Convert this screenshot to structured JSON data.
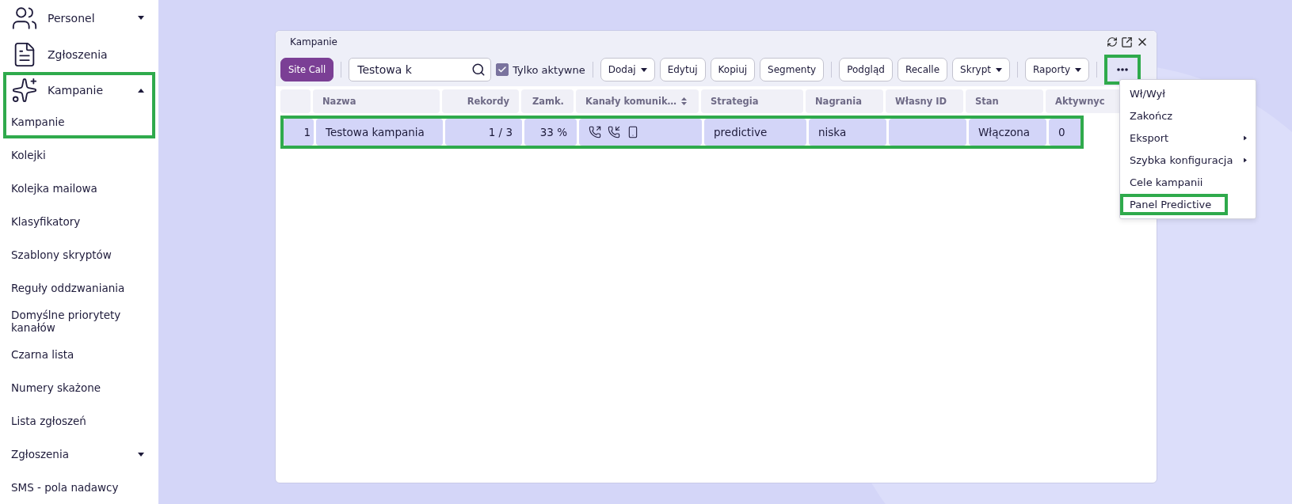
{
  "sidebar": {
    "items": [
      {
        "label": "Personel",
        "kind": "group",
        "expanded": false,
        "highlighted": false
      },
      {
        "label": "Zgłoszenia",
        "kind": "link",
        "highlighted": false
      },
      {
        "label": "Kampanie",
        "kind": "group",
        "expanded": true,
        "highlighted": true,
        "children": [
          {
            "label": "Kampanie",
            "kind": "link",
            "highlighted": true
          },
          {
            "label": "Kolejki",
            "kind": "link",
            "highlighted": false
          },
          {
            "label": "Kolejka mailowa",
            "kind": "link",
            "highlighted": false
          },
          {
            "label": "Klasyfikatory",
            "kind": "link",
            "highlighted": false
          },
          {
            "label": "Szablony skryptów",
            "kind": "link",
            "highlighted": false
          },
          {
            "label": "Reguły oddzwaniania",
            "kind": "link",
            "highlighted": false
          },
          {
            "label": "Domyślne priorytety kanałów",
            "kind": "link",
            "highlighted": false
          },
          {
            "label": "Czarna lista",
            "kind": "link",
            "highlighted": false
          },
          {
            "label": "Numery skażone",
            "kind": "link",
            "highlighted": false
          },
          {
            "label": "Lista zgłoszeń",
            "kind": "link",
            "highlighted": false
          },
          {
            "label": "Zgłoszenia",
            "kind": "group",
            "expanded": false,
            "highlighted": false
          },
          {
            "label": "SMS - pola nadawcy",
            "kind": "link",
            "highlighted": false
          }
        ]
      }
    ]
  },
  "window": {
    "title": "Kampanie",
    "toolbar": {
      "primary": "Site Call",
      "search": {
        "value": "Testowa k"
      },
      "checkbox": {
        "label": "Tylko aktywne",
        "checked": true
      },
      "groups": [
        [
          {
            "label": "Dodaj",
            "dropdown": true
          },
          {
            "label": "Edytuj",
            "dropdown": false
          },
          {
            "label": "Kopiuj",
            "dropdown": false
          },
          {
            "label": "Segmenty",
            "dropdown": false
          }
        ],
        [
          {
            "label": "Podgląd",
            "dropdown": false
          },
          {
            "label": "Recalle",
            "dropdown": false
          },
          {
            "label": "Skrypt",
            "dropdown": true
          }
        ],
        [
          {
            "label": "Raporty",
            "dropdown": true
          }
        ]
      ],
      "more": {
        "highlighted": true
      }
    },
    "table": {
      "columns": [
        {
          "label": "Nazwa",
          "kind": "text",
          "numeric": false,
          "sorted": false
        },
        {
          "label": "Rekordy",
          "kind": "text",
          "numeric": true,
          "sorted": false
        },
        {
          "label": "Zamk.",
          "kind": "text",
          "numeric": true,
          "sorted": false
        },
        {
          "label": "Kanały komunik…",
          "kind": "icons",
          "numeric": false,
          "sorted": true
        },
        {
          "label": "Strategia",
          "kind": "text",
          "numeric": false,
          "sorted": false
        },
        {
          "label": "Nagrania",
          "kind": "text",
          "numeric": false,
          "sorted": false
        },
        {
          "label": "Własny ID",
          "kind": "text",
          "numeric": false,
          "sorted": false
        },
        {
          "label": "Stan",
          "kind": "text",
          "numeric": false,
          "sorted": false
        },
        {
          "label": "Aktywnyc",
          "kind": "text",
          "numeric": false,
          "sorted": false
        }
      ],
      "rows": [
        {
          "number": "1",
          "highlighted": true,
          "cells": [
            "Testowa kampania",
            "1 / 3",
            "33 %",
            null,
            "predictive",
            "niska",
            null,
            "Włączona",
            "0"
          ]
        }
      ]
    },
    "menu": {
      "items": [
        {
          "label": "Wł/Wył",
          "submenu": false,
          "highlighted": false
        },
        {
          "label": "Zakończ",
          "submenu": false,
          "highlighted": false
        },
        {
          "label": "Eksport",
          "submenu": true,
          "highlighted": false
        },
        {
          "label": "Szybka konfiguracja",
          "submenu": true,
          "highlighted": false
        },
        {
          "label": "Cele kampanii",
          "submenu": false,
          "highlighted": false
        },
        {
          "label": "Panel Predictive",
          "submenu": false,
          "highlighted": true
        }
      ]
    }
  }
}
